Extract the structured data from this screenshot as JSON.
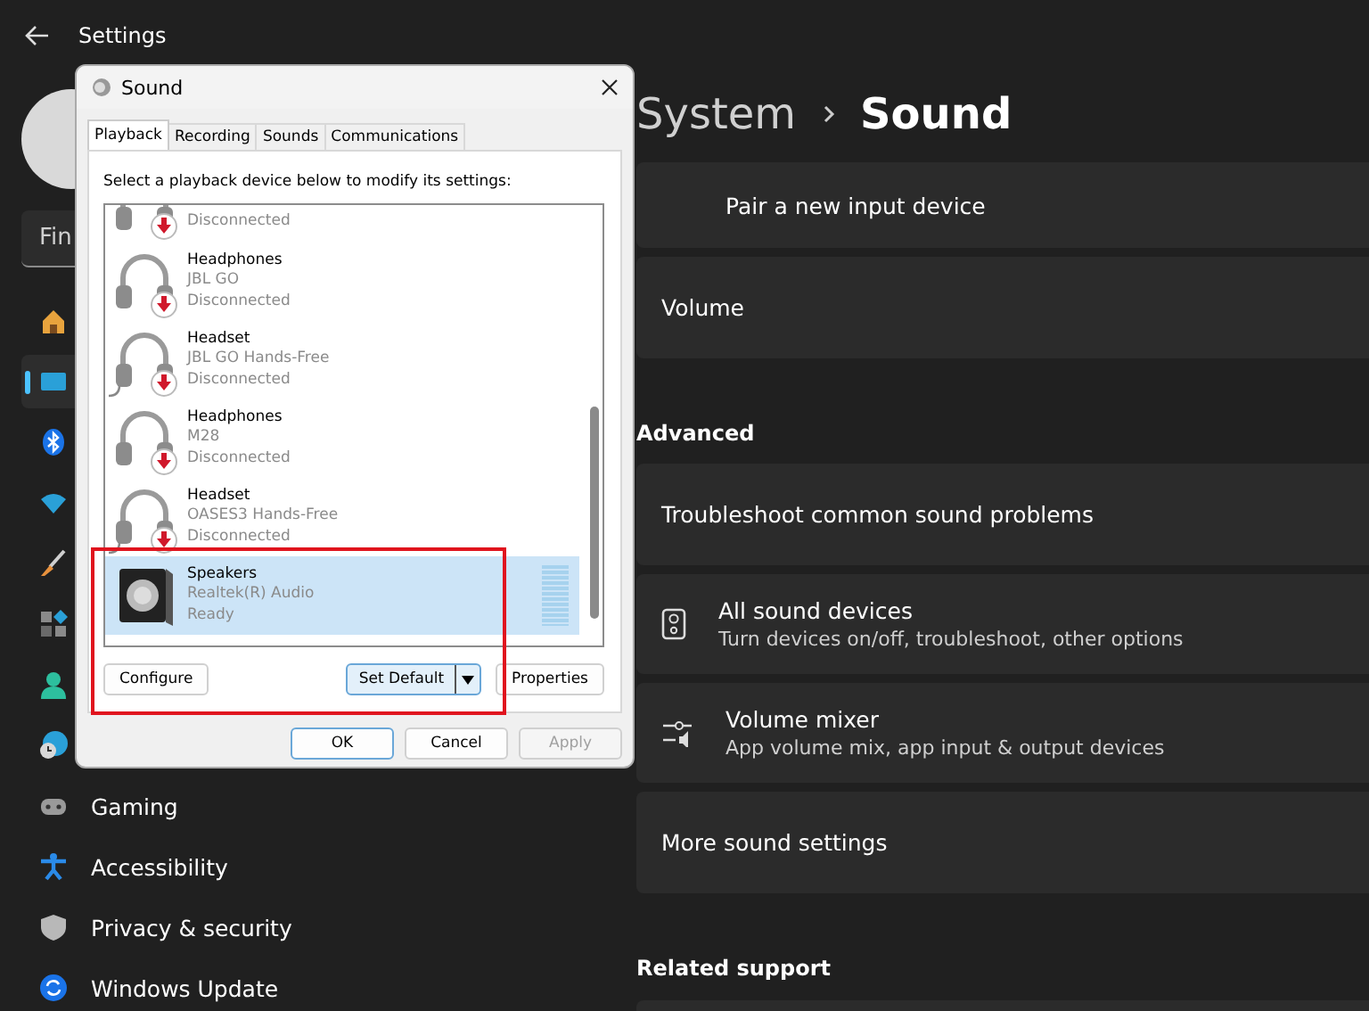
{
  "settings": {
    "title": "Settings",
    "search": {
      "placeholder": "Fin"
    },
    "nav": [
      {
        "kind": "home",
        "selected": false
      },
      {
        "kind": "system",
        "selected": true
      },
      {
        "kind": "bluetooth",
        "selected": false
      },
      {
        "kind": "network",
        "selected": false
      },
      {
        "kind": "personalization",
        "selected": false
      },
      {
        "kind": "apps",
        "selected": false
      },
      {
        "kind": "accounts",
        "selected": false
      },
      {
        "kind": "time",
        "selected": false
      },
      {
        "kind": "gaming",
        "label": "Gaming",
        "selected": false
      },
      {
        "kind": "accessibility",
        "label": "Accessibility",
        "selected": false
      },
      {
        "kind": "privacy",
        "label": "Privacy & security",
        "selected": false
      },
      {
        "kind": "update",
        "label": "Windows Update",
        "selected": false
      }
    ]
  },
  "page": {
    "breadcrumb": [
      "System",
      "Sound"
    ],
    "rows": [
      {
        "kind": "subitem",
        "title": "Pair a new input device"
      },
      {
        "kind": "card",
        "title": "Volume"
      },
      {
        "kind": "heading",
        "title": "Advanced"
      },
      {
        "kind": "card",
        "title": "Troubleshoot common sound problems"
      },
      {
        "kind": "speaker-card",
        "title": "All sound devices",
        "subtitle": "Turn devices on/off, troubleshoot, other options"
      },
      {
        "kind": "mixer-card",
        "title": "Volume mixer",
        "subtitle": "App volume mix, app input & output devices"
      },
      {
        "kind": "card",
        "title": "More sound settings"
      },
      {
        "kind": "heading",
        "title": "Related support"
      },
      {
        "kind": "card-stub"
      }
    ]
  },
  "dialog": {
    "title": "Sound",
    "tabs": [
      {
        "label": "Playback",
        "selected": true
      },
      {
        "label": "Recording",
        "selected": false
      },
      {
        "label": "Sounds",
        "selected": false
      },
      {
        "label": "Communications",
        "selected": false
      }
    ],
    "instruction": "Select a playback device below to modify its settings:",
    "devices": [
      {
        "kind": "headphones",
        "status": "Disconnected",
        "connected": false,
        "selected": false
      },
      {
        "kind": "headphones",
        "name": "Headphones",
        "description": "JBL GO",
        "status": "Disconnected",
        "connected": false,
        "selected": false
      },
      {
        "kind": "headset",
        "name": "Headset",
        "description": "JBL GO Hands-Free",
        "status": "Disconnected",
        "connected": false,
        "selected": false
      },
      {
        "kind": "headphones",
        "name": "Headphones",
        "description": "M28",
        "status": "Disconnected",
        "connected": false,
        "selected": false
      },
      {
        "kind": "headset",
        "name": "Headset",
        "description": "OASES3 Hands-Free",
        "status": "Disconnected",
        "connected": false,
        "selected": false
      },
      {
        "kind": "speakers",
        "name": "Speakers",
        "description": "Realtek(R) Audio",
        "status": "Ready",
        "connected": true,
        "selected": true
      }
    ],
    "configure": "Configure",
    "set_default": "Set Default",
    "properties": "Properties",
    "footer": [
      {
        "label": "OK",
        "disabled": false,
        "default": true
      },
      {
        "label": "Cancel",
        "disabled": false,
        "default": false
      },
      {
        "label": "Apply",
        "disabled": true,
        "default": false
      }
    ]
  }
}
